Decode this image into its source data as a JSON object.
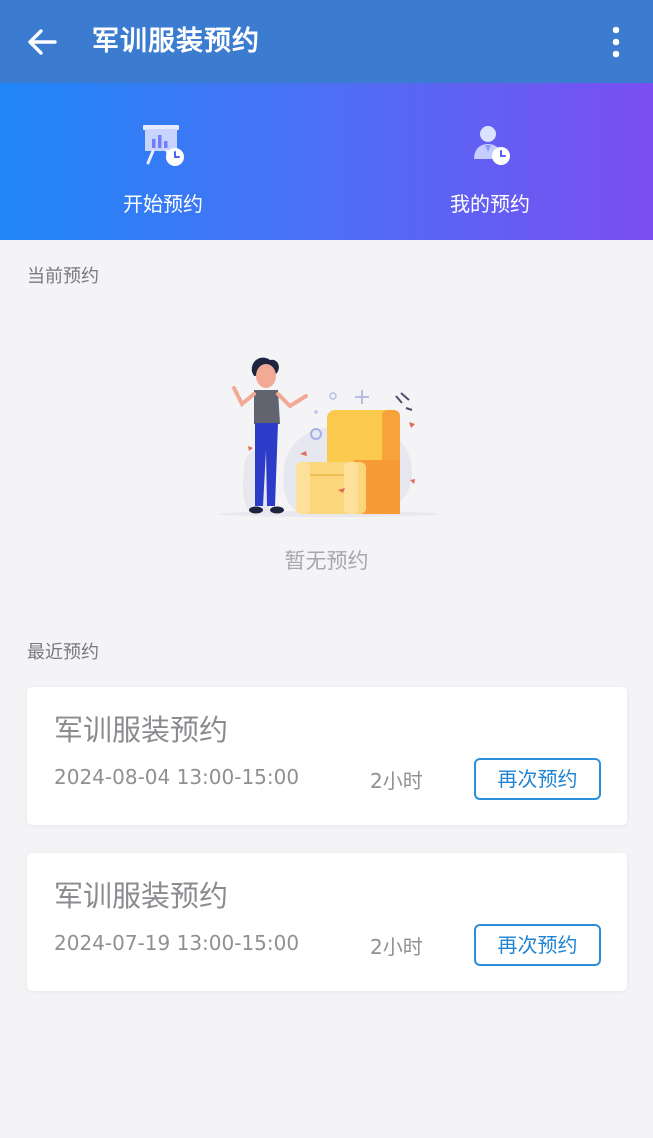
{
  "appbar": {
    "title": "军训服装预约",
    "back_icon": "arrow-left-icon",
    "more_icon": "more-vertical-icon"
  },
  "hero": {
    "colors": {
      "start": "#1f86f7",
      "end": "#7a4ef0"
    },
    "actions": [
      {
        "label": "开始预约",
        "icon": "presentation-chart-clock-icon"
      },
      {
        "label": "我的预约",
        "icon": "user-clock-icon"
      }
    ]
  },
  "current": {
    "section_label": "当前预约",
    "empty_text": "暂无预约",
    "empty_illustration": "empty-state-illustration"
  },
  "recent": {
    "section_label": "最近预约",
    "items": [
      {
        "title": "军训服装预约",
        "time": "2024-08-04 13:00-15:00",
        "duration": "2小时",
        "action": "再次预约"
      },
      {
        "title": "军训服装预约",
        "time": "2024-07-19 13:00-15:00",
        "duration": "2小时",
        "action": "再次预约"
      }
    ]
  },
  "colors": {
    "appbar": "#3b7bd0",
    "background": "#f4f4f6",
    "accent": "#1f84d4"
  }
}
